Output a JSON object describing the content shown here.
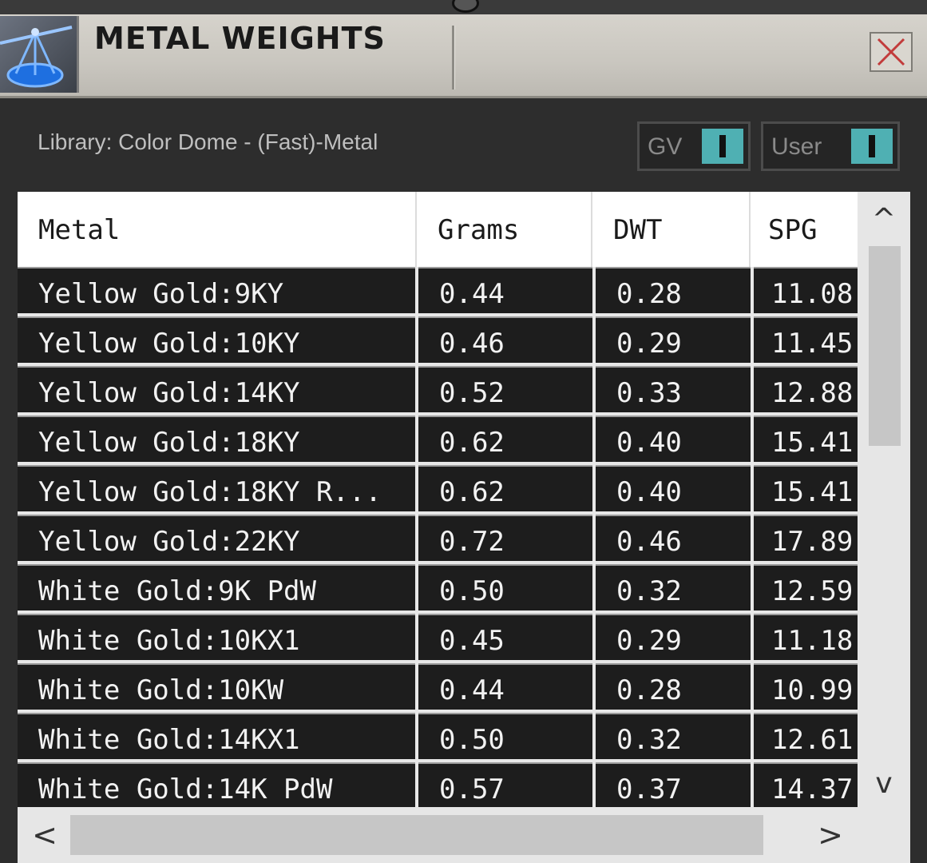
{
  "window": {
    "title": "METAL WEIGHTS",
    "close_symbol": "✕",
    "app_icon": "scale-icon"
  },
  "library": {
    "label": "Library: Color Dome - (Fast)-Metal"
  },
  "toggles": [
    {
      "label": "GV",
      "state": "on"
    },
    {
      "label": "User",
      "state": "on"
    }
  ],
  "colors": {
    "toggle_accent": "#4fb0b3",
    "close_x": "#c23b3b",
    "row_bg": "#1d1d1d"
  },
  "table": {
    "columns": [
      "Metal",
      "Grams",
      "DWT",
      "SPG"
    ],
    "rows": [
      [
        "Yellow Gold:9KY",
        "0.44",
        "0.28",
        "11.08"
      ],
      [
        "Yellow Gold:10KY",
        "0.46",
        "0.29",
        "11.45"
      ],
      [
        "Yellow Gold:14KY",
        "0.52",
        "0.33",
        "12.88"
      ],
      [
        "Yellow Gold:18KY",
        "0.62",
        "0.40",
        "15.41"
      ],
      [
        "Yellow Gold:18KY R...",
        "0.62",
        "0.40",
        "15.41"
      ],
      [
        "Yellow Gold:22KY",
        "0.72",
        "0.46",
        "17.89"
      ],
      [
        "White Gold:9K PdW",
        "0.50",
        "0.32",
        "12.59"
      ],
      [
        "White Gold:10KX1",
        "0.45",
        "0.29",
        "11.18"
      ],
      [
        "White Gold:10KW",
        "0.44",
        "0.28",
        "10.99"
      ],
      [
        "White Gold:14KX1",
        "0.50",
        "0.32",
        "12.61"
      ],
      [
        "White Gold:14K PdW",
        "0.57",
        "0.37",
        "14.37"
      ]
    ]
  },
  "scrollbars": {
    "up": "^",
    "down": "v",
    "left": "<",
    "right": ">"
  }
}
